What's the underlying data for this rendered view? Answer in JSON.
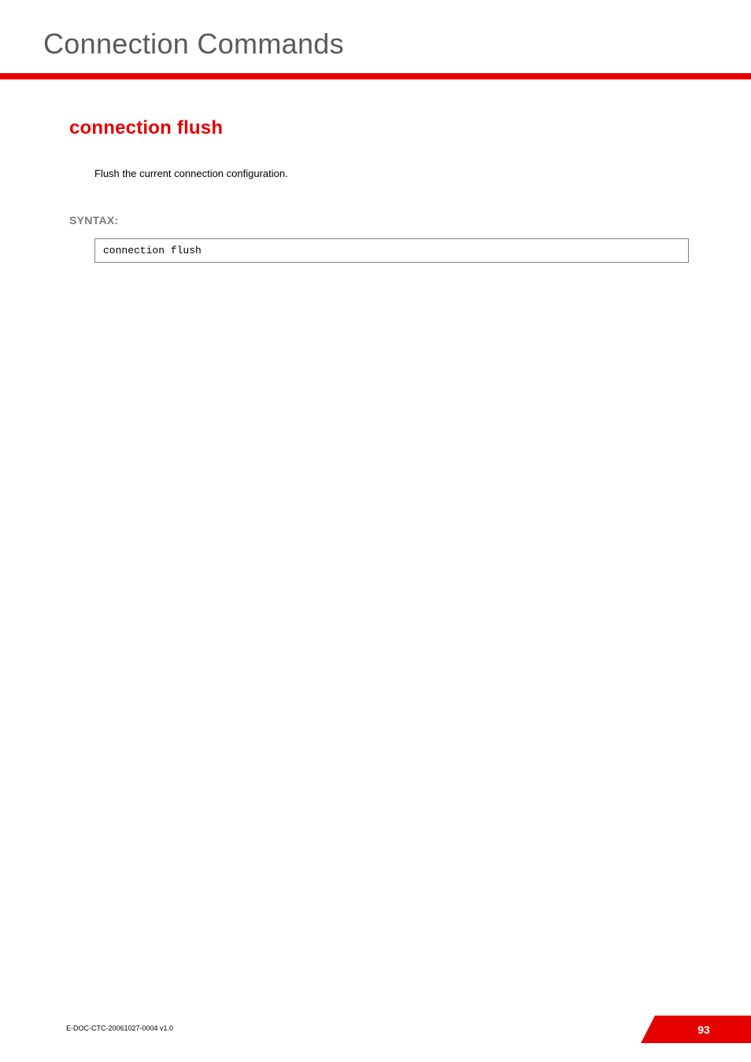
{
  "header": {
    "title": "Connection Commands"
  },
  "section": {
    "title": "connection flush",
    "description": "Flush the current connection configuration."
  },
  "syntax": {
    "label": "SYNTAX:",
    "code": "connection flush"
  },
  "footer": {
    "doc_id": "E-DOC-CTC-20061027-0004 v1.0",
    "page_number": "93"
  }
}
